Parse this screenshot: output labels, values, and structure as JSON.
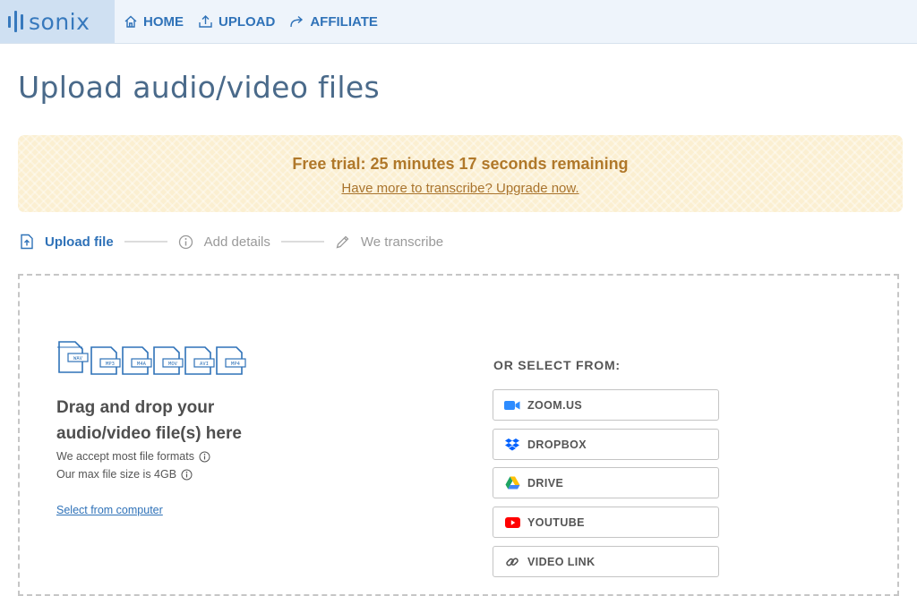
{
  "brand": {
    "name": "sonix",
    "color": "#3779bd"
  },
  "nav": {
    "items": [
      {
        "label": "HOME",
        "icon": "home-icon"
      },
      {
        "label": "UPLOAD",
        "icon": "upload-icon"
      },
      {
        "label": "AFFILIATE",
        "icon": "share-arrow-icon"
      }
    ]
  },
  "page": {
    "title": "Upload audio/video files"
  },
  "trial": {
    "message": "Free trial: 25 minutes 17 seconds remaining",
    "upgrade_link": "Have more to transcribe? Upgrade now."
  },
  "steps": [
    {
      "label": "Upload file",
      "icon": "upload-file-icon",
      "active": true
    },
    {
      "label": "Add details",
      "icon": "info-icon",
      "active": false
    },
    {
      "label": "We transcribe",
      "icon": "pencil-icon",
      "active": false
    }
  ],
  "dropzone": {
    "file_formats": [
      "WAV",
      "MP3",
      "M4A",
      "MOV",
      "AVI",
      "MP4"
    ],
    "title_line1": "Drag and drop your",
    "title_line2": "audio/video file(s) here",
    "formats_hint": "We accept most file formats",
    "size_hint": "Our max file size is 4GB",
    "select_link": "Select from computer"
  },
  "sources": {
    "heading": "OR SELECT FROM:",
    "items": [
      {
        "label": "ZOOM.US",
        "icon": "zoom-icon",
        "color": "#2d8cff"
      },
      {
        "label": "DROPBOX",
        "icon": "dropbox-icon",
        "color": "#0061ff"
      },
      {
        "label": "DRIVE",
        "icon": "google-drive-icon",
        "color": "#1fa463"
      },
      {
        "label": "YOUTUBE",
        "icon": "youtube-icon",
        "color": "#ff0000"
      },
      {
        "label": "VIDEO LINK",
        "icon": "link-icon",
        "color": "#555555"
      }
    ]
  }
}
